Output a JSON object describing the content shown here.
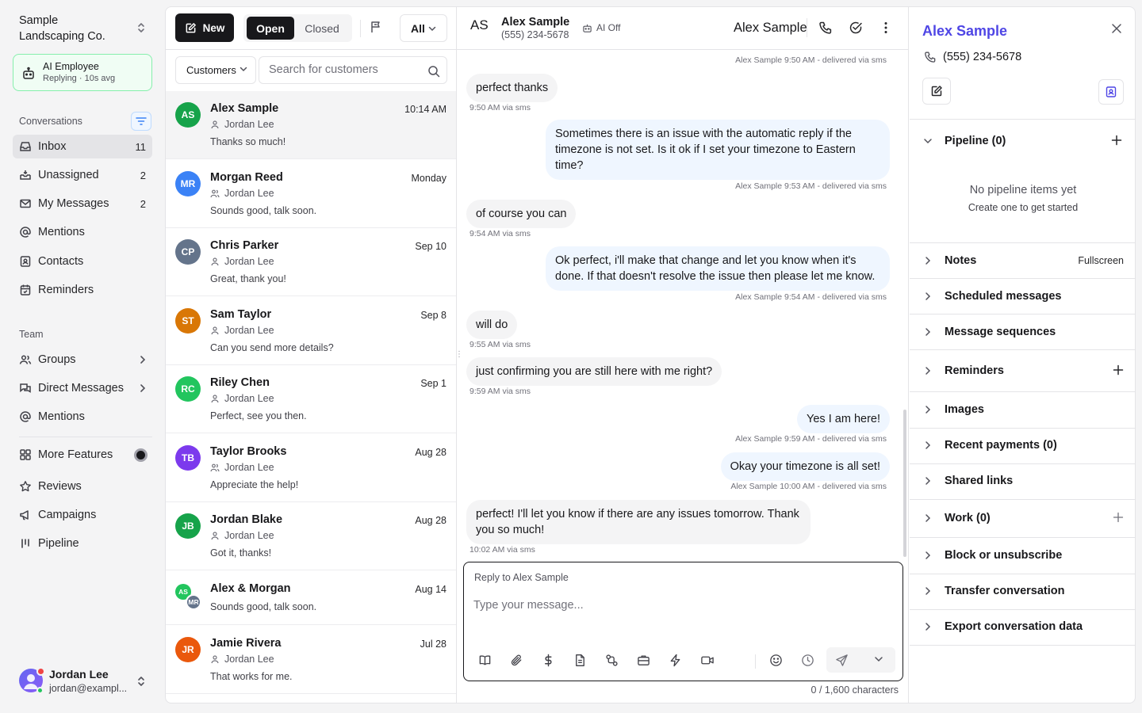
{
  "workspace": {
    "name": "Sample Landscaping Co."
  },
  "ai_employee": {
    "title": "AI Employee",
    "status": "Replying · 10s avg"
  },
  "sidebar": {
    "conversations_label": "Conversations",
    "items": [
      {
        "label": "Inbox",
        "count": "11",
        "icon": "inbox-icon"
      },
      {
        "label": "Unassigned",
        "count": "2",
        "icon": "inbox-in-icon"
      },
      {
        "label": "My Messages",
        "count": "2",
        "icon": "mail-icon"
      },
      {
        "label": "Mentions",
        "count": "",
        "icon": "at-icon"
      },
      {
        "label": "Contacts",
        "count": "",
        "icon": "contact-card-icon"
      },
      {
        "label": "Reminders",
        "count": "",
        "icon": "calendar-icon"
      }
    ],
    "team_label": "Team",
    "team_items": [
      {
        "label": "Groups",
        "icon": "users-icon"
      },
      {
        "label": "Direct Messages",
        "icon": "chat-icon"
      },
      {
        "label": "Mentions",
        "icon": "at-icon"
      }
    ],
    "more_features": "More Features",
    "extra_items": [
      {
        "label": "Reviews",
        "icon": "star-icon"
      },
      {
        "label": "Campaigns",
        "icon": "megaphone-icon"
      },
      {
        "label": "Pipeline",
        "icon": "pipeline-icon"
      }
    ]
  },
  "user": {
    "name": "Jordan Lee",
    "email": "jordan@exampl..."
  },
  "toolbar": {
    "new_label": "New",
    "open_label": "Open",
    "closed_label": "Closed",
    "filter_label": "All",
    "customers_label": "Customers",
    "search_placeholder": "Search for customers"
  },
  "conversations": [
    {
      "initials": "AS",
      "name": "Alex Sample",
      "time": "10:14 AM",
      "assignee": "Jordan Lee",
      "snippet": "Thanks so much!",
      "color": "#16a34a"
    },
    {
      "initials": "MR",
      "name": "Morgan Reed",
      "time": "Monday",
      "assignee": "Jordan Lee",
      "snippet": "Sounds good, talk soon.",
      "color": "#3b82f6"
    },
    {
      "initials": "CP",
      "name": "Chris Parker",
      "time": "Sep 10",
      "assignee": "Jordan Lee",
      "snippet": "Great, thank you!",
      "color": "#64748b"
    },
    {
      "initials": "ST",
      "name": "Sam Taylor",
      "time": "Sep 8",
      "assignee": "Jordan Lee",
      "snippet": "Can you send more details?",
      "color": "#d97706"
    },
    {
      "initials": "RC",
      "name": "Riley Chen",
      "time": "Sep 1",
      "assignee": "Jordan Lee",
      "snippet": "Perfect, see you then.",
      "color": "#22c55e"
    },
    {
      "initials": "TB",
      "name": "Taylor Brooks",
      "time": "Aug 28",
      "assignee": "Jordan Lee",
      "snippet": "Appreciate the help!",
      "color": "#7c3aed"
    },
    {
      "initials": "JB",
      "name": "Jordan Blake",
      "time": "Aug 28",
      "assignee": "Jordan Lee",
      "snippet": "Got it, thanks!",
      "color": "#16a34a"
    },
    {
      "initials": "AS",
      "initials2": "MR",
      "name": "Alex & Morgan",
      "time": "Aug 14",
      "assignee": "",
      "snippet": "Sounds good, talk soon.",
      "color": "#22c55e"
    },
    {
      "initials": "JR",
      "name": "Jamie Rivera",
      "time": "Jul 28",
      "assignee": "Jordan Lee",
      "snippet": "That works for me.",
      "color": "#ea580c"
    }
  ],
  "chat": {
    "initials": "AS",
    "name": "Alex Sample",
    "phone": "(555) 234-5678",
    "ai_status": "AI Off",
    "title": "Alex Sample",
    "top_meta": "Alex Sample 9:50 AM - delivered via sms",
    "messages": [
      {
        "dir": "in",
        "text": "perfect thanks",
        "meta": "9:50 AM via sms"
      },
      {
        "dir": "out",
        "text": "Sometimes there is an issue with the automatic reply if the timezone is not set. Is it ok if I set your timezone to Eastern time?",
        "meta": "Alex Sample 9:53 AM - delivered via sms"
      },
      {
        "dir": "in",
        "text": "of course you can",
        "meta": "9:54 AM via sms"
      },
      {
        "dir": "out",
        "text": "Ok perfect, i'll make that change and let you know when it's done. If that doesn't resolve the issue then please let me know.",
        "meta": "Alex Sample 9:54 AM - delivered via sms"
      },
      {
        "dir": "in",
        "text": "will do",
        "meta": "9:55 AM via sms"
      },
      {
        "dir": "in",
        "text": "just confirming you are still here with me right?",
        "meta": "9:59 AM via sms"
      },
      {
        "dir": "out",
        "text": "Yes I am here!",
        "meta": "Alex Sample 9:59 AM - delivered via sms"
      },
      {
        "dir": "out",
        "text": "Okay your timezone is all set!",
        "meta": "Alex Sample 10:00 AM - delivered via sms"
      },
      {
        "dir": "in",
        "text": "perfect! I'll let you know if there are any issues tomorrow. Thank you so much!",
        "meta": "10:02 AM via sms"
      }
    ],
    "reply_to": "Reply to Alex Sample",
    "placeholder": "Type your message...",
    "char_count": "0 / 1,600 characters"
  },
  "details": {
    "name": "Alex Sample",
    "phone": "(555) 234-5678",
    "pipeline_label": "Pipeline (0)",
    "pipeline_empty": "No pipeline items yet",
    "pipeline_empty_hint": "Create one to get started",
    "notes_label": "Notes",
    "notes_action": "Fullscreen",
    "sections": [
      "Scheduled messages",
      "Message sequences",
      "Reminders",
      "Images",
      "Recent payments (0)",
      "Shared links",
      "Work (0)",
      "Block or unsubscribe",
      "Transfer conversation",
      "Export conversation data"
    ]
  }
}
